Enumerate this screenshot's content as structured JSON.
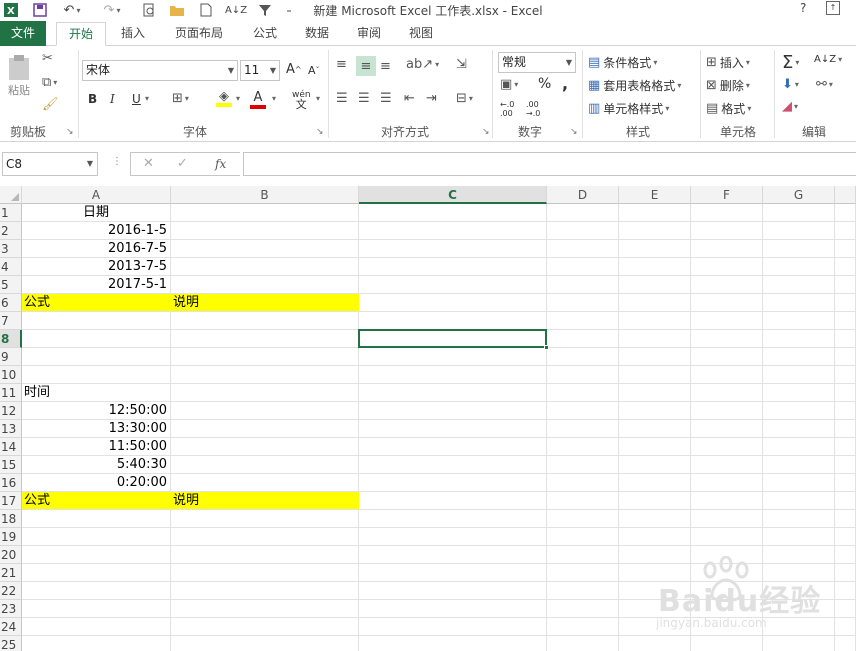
{
  "window": {
    "title": "新建 Microsoft Excel 工作表.xlsx - Excel",
    "help": "?",
    "accent": "#217346"
  },
  "tabs": [
    {
      "label": "文件"
    },
    {
      "label": "开始"
    },
    {
      "label": "插入"
    },
    {
      "label": "页面布局"
    },
    {
      "label": "公式"
    },
    {
      "label": "数据"
    },
    {
      "label": "审阅"
    },
    {
      "label": "视图"
    }
  ],
  "ribbon": {
    "clipboard": {
      "label": "剪贴板",
      "paste": "粘贴"
    },
    "font": {
      "label": "字体",
      "name": "宋体",
      "size": "11",
      "bold": "B",
      "italic": "I",
      "underline": "U",
      "phonetic": "wén"
    },
    "alignment": {
      "label": "对齐方式"
    },
    "number": {
      "label": "数字",
      "format": "常规",
      "percent": "%",
      "comma": ","
    },
    "styles": {
      "label": "样式",
      "conditional": "条件格式",
      "table": "套用表格格式",
      "cell": "单元格样式"
    },
    "cells": {
      "label": "单元格",
      "insert": "插入",
      "delete": "删除",
      "format": "格式"
    },
    "editing": {
      "label": "编辑"
    }
  },
  "formula_bar": {
    "name_box": "C8",
    "fx": "fx",
    "value": ""
  },
  "sheet": {
    "columns": [
      "A",
      "B",
      "C",
      "D",
      "E",
      "F",
      "G"
    ],
    "selected_column": "C",
    "selected_row": "8",
    "rows": [
      "1",
      "2",
      "3",
      "4",
      "5",
      "6",
      "7",
      "8",
      "9",
      "10",
      "11",
      "12",
      "13",
      "14",
      "15",
      "16",
      "17",
      "18",
      "19",
      "20",
      "21",
      "22",
      "23",
      "24",
      "25"
    ],
    "cells": {
      "A1": "日期",
      "A2": "2016-1-5",
      "A3": "2016-7-5",
      "A4": "2013-7-5",
      "A5": "2017-5-1",
      "A6": "公式",
      "B6": "说明",
      "A11": "时间",
      "A12": "12:50:00",
      "A13": "13:30:00",
      "A14": "11:50:00",
      "A15": "5:40:30",
      "A16": "0:20:00",
      "A17": "公式",
      "B17": "说明"
    },
    "highlight_color": "#ffff00"
  },
  "watermark": {
    "brand": "Baidu经验",
    "url": "jingyan.baidu.com"
  }
}
